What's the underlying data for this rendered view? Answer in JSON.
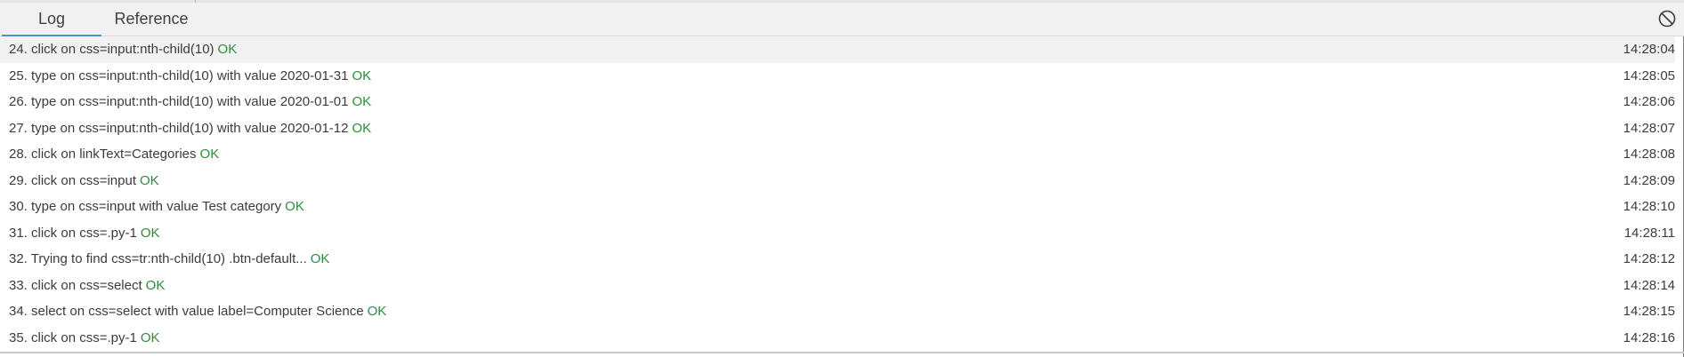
{
  "tabs": {
    "log": "Log",
    "reference": "Reference"
  },
  "toolbar": {
    "clear_icon": "prohibit-icon"
  },
  "colors": {
    "status_ok": "#2e8b3e",
    "active_tab_underline": "#4a90d9",
    "first_row_background": "#f1f1f1"
  },
  "log": {
    "entries": [
      {
        "text": "24. click on css=input:nth-child(10)",
        "status": "OK",
        "time": "14:28:04"
      },
      {
        "text": "25. type on css=input:nth-child(10) with value 2020-01-31",
        "status": "OK",
        "time": "14:28:05"
      },
      {
        "text": "26. type on css=input:nth-child(10) with value 2020-01-01",
        "status": "OK",
        "time": "14:28:06"
      },
      {
        "text": "27. type on css=input:nth-child(10) with value 2020-01-12",
        "status": "OK",
        "time": "14:28:07"
      },
      {
        "text": "28. click on linkText=Categories",
        "status": "OK",
        "time": "14:28:08"
      },
      {
        "text": "29. click on css=input",
        "status": "OK",
        "time": "14:28:09"
      },
      {
        "text": "30. type on css=input with value Test category",
        "status": "OK",
        "time": "14:28:10"
      },
      {
        "text": "31. click on css=.py-1",
        "status": "OK",
        "time": "14:28:11"
      },
      {
        "text": "32. Trying to find css=tr:nth-child(10) .btn-default...",
        "status": "OK",
        "time": "14:28:12"
      },
      {
        "text": "33. click on css=select",
        "status": "OK",
        "time": "14:28:14"
      },
      {
        "text": "34. select on css=select with value label=Computer Science",
        "status": "OK",
        "time": "14:28:15"
      },
      {
        "text": "35. click on css=.py-1",
        "status": "OK",
        "time": "14:28:16"
      }
    ]
  }
}
